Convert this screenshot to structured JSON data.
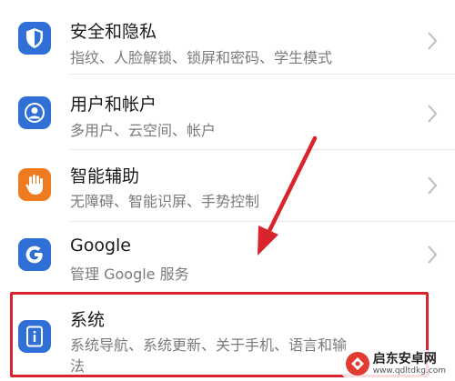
{
  "settings": {
    "items": [
      {
        "title": "安全和隐私",
        "subtitle": "指纹、人脸解锁、锁屏和密码、学生模式",
        "icon": "shield-icon",
        "color": "#2f6fd6"
      },
      {
        "title": "用户和帐户",
        "subtitle": "多用户、云空间、帐户",
        "icon": "user-icon",
        "color": "#2f6fd6"
      },
      {
        "title": "智能辅助",
        "subtitle": "无障碍、智能识屏、手势控制",
        "icon": "hand-icon",
        "color": "#f07a1e"
      },
      {
        "title": "Google",
        "subtitle": "管理 Google 服务",
        "icon": "google-icon",
        "color": "#2f6fd6"
      },
      {
        "title": "系统",
        "subtitle": "系统导航、系统更新、关于手机、语言和输",
        "subtitle2": "法",
        "icon": "system-info-icon",
        "color": "#2f6fd6"
      }
    ]
  },
  "annotation": {
    "highlight_color": "#d9232d",
    "arrow_color": "#d9232d"
  },
  "watermark": {
    "name": "启东安卓网",
    "url": "www.qdltdkg.com"
  }
}
